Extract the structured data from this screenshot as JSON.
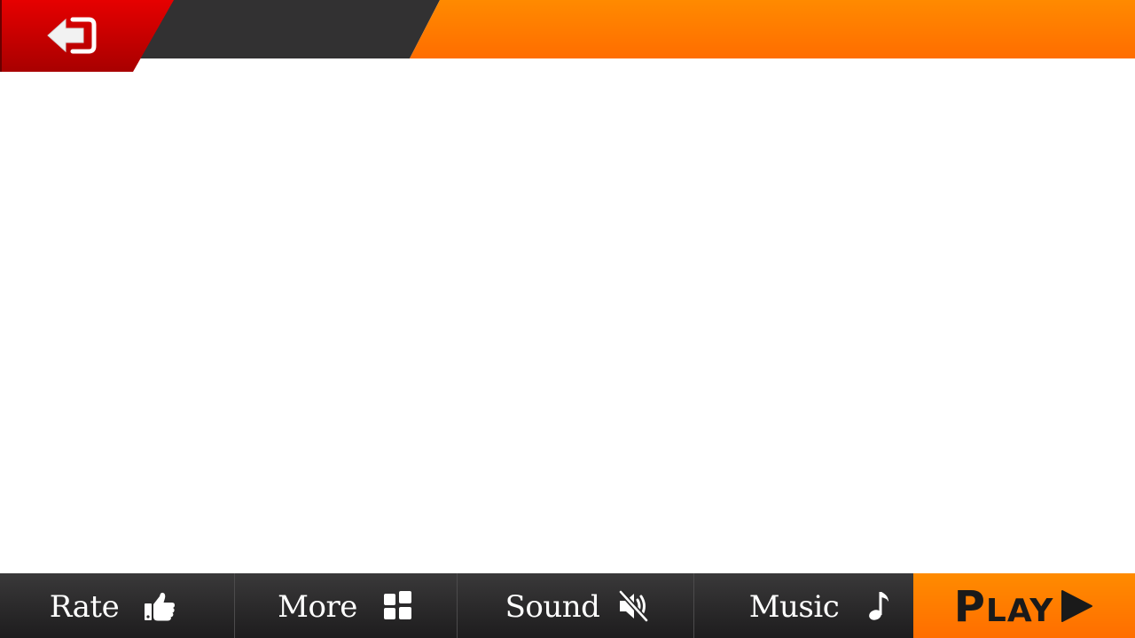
{
  "header": {
    "back_icon": "exit-arrow-icon"
  },
  "bottom_nav": {
    "rate": {
      "label": "Rate",
      "icon": "thumbs-up-icon"
    },
    "more": {
      "label": "More",
      "icon": "grid-icon"
    },
    "sound": {
      "label": "Sound",
      "icon": "speaker-muted-icon"
    },
    "music": {
      "label": "Music",
      "icon": "music-note-icon"
    },
    "play": {
      "label_first": "P",
      "label_rest": "LAY",
      "icon": "play-triangle-icon"
    }
  },
  "colors": {
    "accent_orange": "#ff7a00",
    "back_red": "#d40000",
    "bar_dark": "#323132"
  }
}
